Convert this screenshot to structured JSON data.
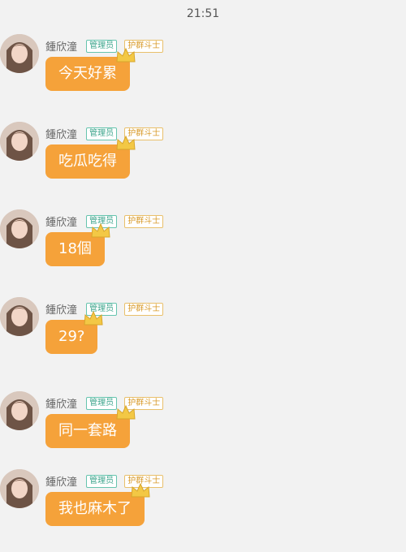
{
  "status_bar": {
    "time": "21:51"
  },
  "messages": [
    {
      "sender": "鍾欣潼",
      "badge_admin": "管理员",
      "badge_guard": "护群斗士",
      "text": "今天好累"
    },
    {
      "sender": "鍾欣潼",
      "badge_admin": "管理员",
      "badge_guard": "护群斗士",
      "text": "吃瓜吃得"
    },
    {
      "sender": "鍾欣潼",
      "badge_admin": "管理员",
      "badge_guard": "护群斗士",
      "text": "18個"
    },
    {
      "sender": "鍾欣潼",
      "badge_admin": "管理员",
      "badge_guard": "护群斗士",
      "text": "29?"
    },
    {
      "sender": "鍾欣潼",
      "badge_admin": "管理员",
      "badge_guard": "护群斗士",
      "text": "同一套路"
    },
    {
      "sender": "鍾欣潼",
      "badge_admin": "管理员",
      "badge_guard": "护群斗士",
      "text": "我也麻木了"
    }
  ],
  "icons": {
    "avatar": "avatar",
    "crown": "crown-icon"
  },
  "colors": {
    "background": "#f2f2f2",
    "bubble": "#f5a23a",
    "admin_badge": "#3aa38a",
    "guard_badge": "#d89a2a",
    "crown": "#f3c845"
  }
}
